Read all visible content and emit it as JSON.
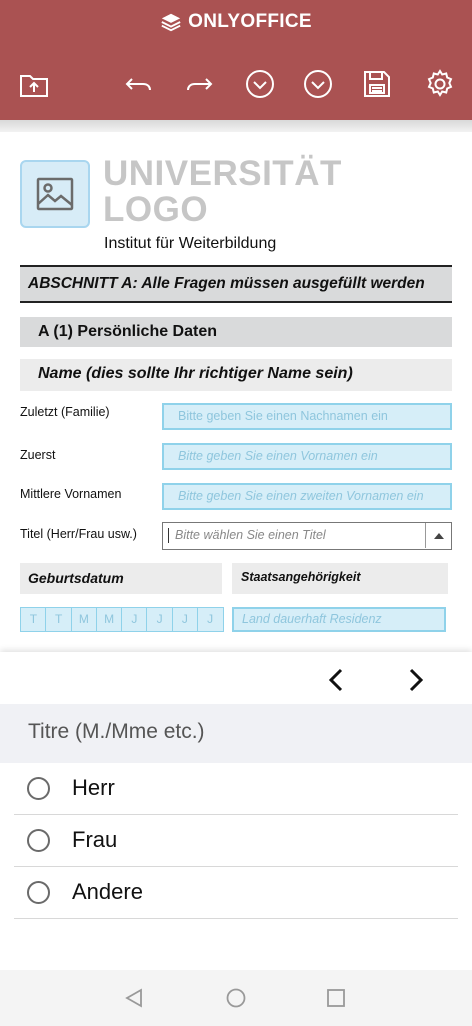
{
  "app": {
    "brand": "ONLYOFFICE",
    "accent_color": "#aa5252",
    "toolbar": [
      {
        "name": "open-file-icon"
      },
      {
        "name": "undo-icon"
      },
      {
        "name": "redo-icon"
      },
      {
        "name": "previous-field-icon"
      },
      {
        "name": "next-field-icon"
      },
      {
        "name": "save-icon"
      },
      {
        "name": "settings-icon"
      }
    ]
  },
  "document": {
    "logo_line1": "UNIVERSITÄT",
    "logo_line2": "LOGO",
    "institut": "Institut für Weiterbildung",
    "section_a": "ABSCHNITT A: Alle Fragen müssen ausgefüllt werden",
    "section_a1": "A (1) Persönliche Daten",
    "name_header": "Name (dies sollte Ihr richtiger Name sein)",
    "fields": {
      "last_name_label": "Zuletzt (Familie)",
      "last_name_placeholder": "Bitte geben Sie einen Nachnamen ein",
      "first_name_label": "Zuerst",
      "first_name_placeholder": "Bitte geben Sie einen Vornamen ein",
      "middle_name_label": "Mittlere Vornamen",
      "middle_name_placeholder": "Bitte geben Sie einen zweiten Vornamen ein",
      "title_label": "Titel (Herr/Frau usw.)",
      "title_placeholder": "Bitte wählen Sie einen Titel"
    },
    "birthdate_header": "Geburtsdatum",
    "nationality_header": "Staatsangehörigkeit",
    "date_cells": [
      "T",
      "T",
      "M",
      "M",
      "J",
      "J",
      "J",
      "J"
    ],
    "residence_placeholder": "Land dauerhaft Residenz"
  },
  "sheet": {
    "title": "Titre (M./Mme etc.)",
    "options": [
      "Herr",
      "Frau",
      "Andere"
    ]
  }
}
